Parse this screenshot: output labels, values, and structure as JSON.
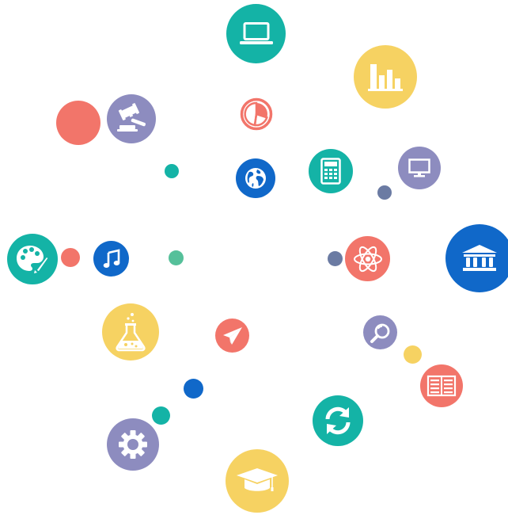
{
  "palette": {
    "teal": "#14B3A6",
    "yellow": "#F6D262",
    "coral": "#F2756A",
    "purple": "#8D8CBF",
    "blue": "#1068C9",
    "slate": "#6B7BA3",
    "green": "#55C09A",
    "white": "#FFFFFF"
  },
  "icons": [
    "laptop-icon",
    "bar-chart-icon",
    "pie-chart-icon",
    "gavel-icon",
    "globe-icon",
    "calculator-icon",
    "monitor-icon",
    "palette-icon",
    "music-note-icon",
    "atom-icon",
    "bank-icon",
    "flask-icon",
    "paper-plane-icon",
    "magnifier-icon",
    "book-icon",
    "refresh-icon",
    "gear-icon",
    "graduation-cap-icon"
  ]
}
